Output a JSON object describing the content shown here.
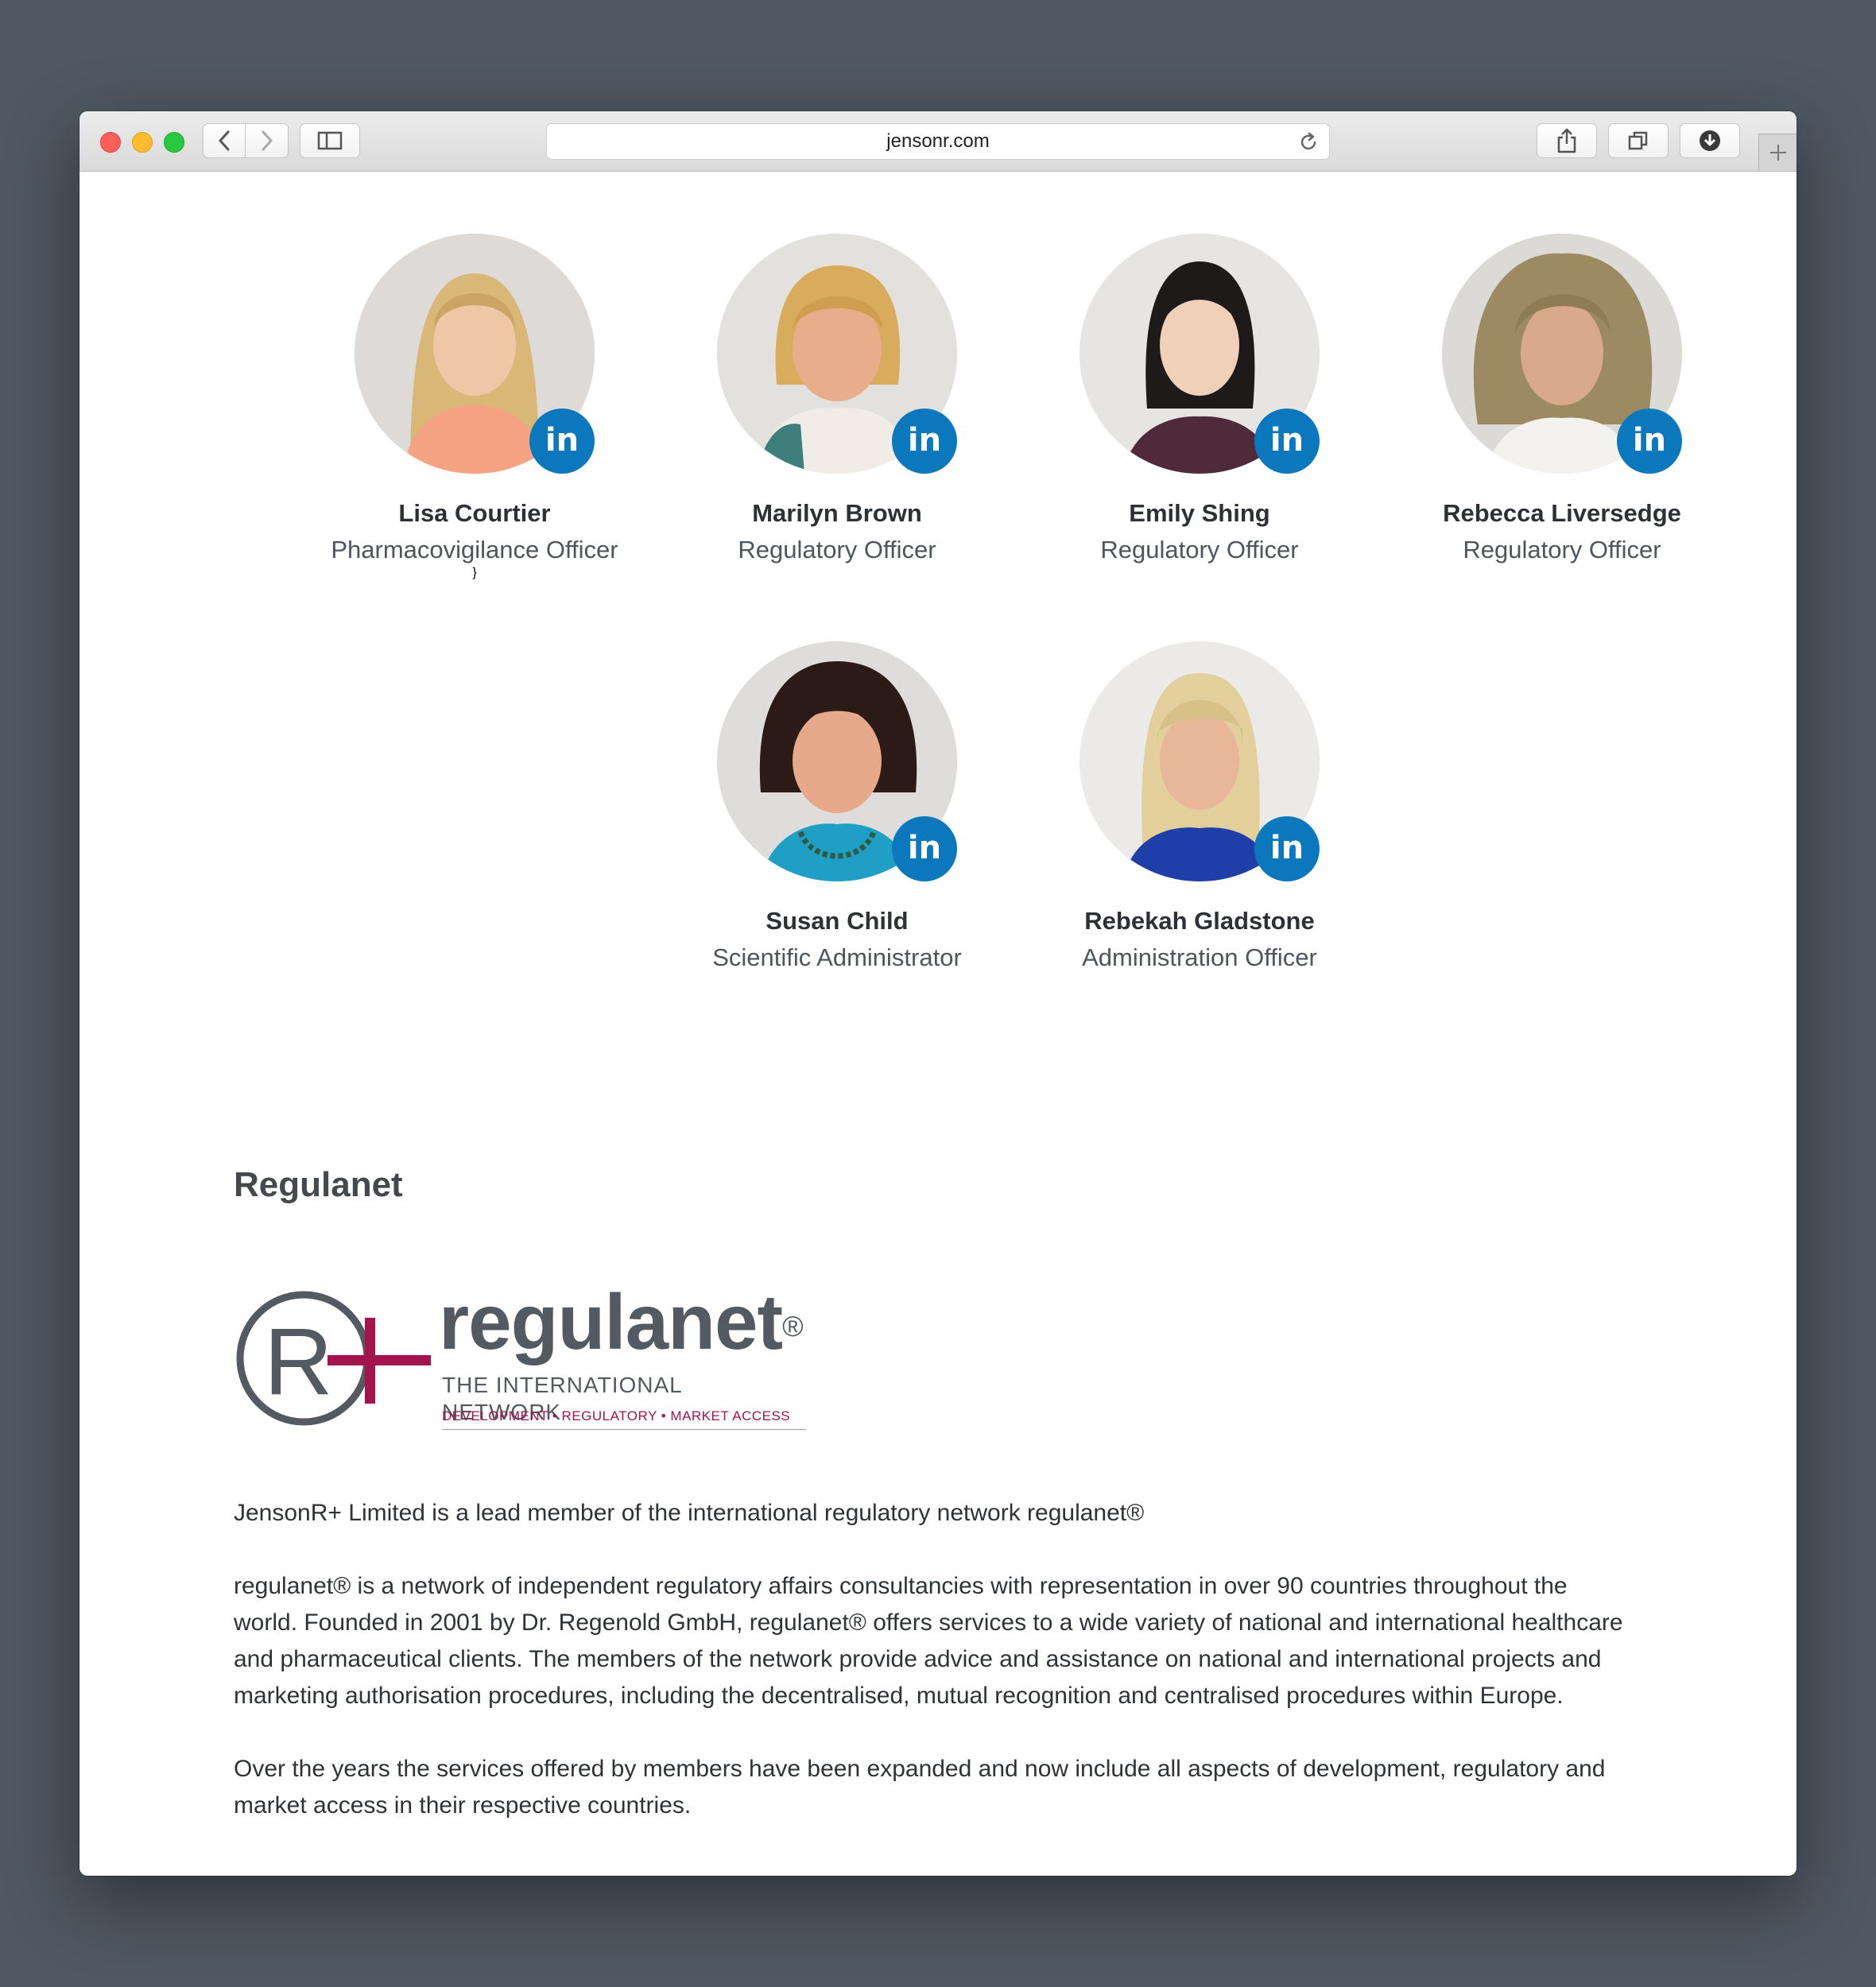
{
  "browser": {
    "url": "jensonr.com"
  },
  "team": [
    {
      "name": "Lisa Courtier",
      "role": "Pharmacovigilance Officer",
      "linkedin": "in"
    },
    {
      "name": "Marilyn Brown",
      "role": "Regulatory Officer",
      "linkedin": "in"
    },
    {
      "name": "Emily Shing",
      "role": "Regulatory Officer",
      "linkedin": "in"
    },
    {
      "name": "Rebecca Liversedge",
      "role": "Regulatory Officer",
      "linkedin": "in"
    },
    {
      "name": "Susan Child",
      "role": "Scientific Administrator",
      "linkedin": "in"
    },
    {
      "name": "Rebekah Gladstone",
      "role": "Administration Officer",
      "linkedin": "in"
    }
  ],
  "regulanet": {
    "heading": "Regulanet",
    "logo": {
      "wordmark": "regulanet",
      "registered": "®",
      "tagline": "THE INTERNATIONAL NETWORK",
      "services": "DEVELOPMENT • REGULATORY • MARKET ACCESS",
      "mark_letters": "R+"
    },
    "paragraphs": [
      "JensonR+ Limited is a lead member of the international regulatory network regulanet®",
      "regulanet® is a network of independent regulatory affairs consultancies with representation in over 90 countries throughout the world. Founded in 2001 by Dr. Regenold GmbH, regulanet® offers services to a wide variety of national and international healthcare and pharmaceutical clients. The members of the network provide advice and assistance on national and international projects and marketing authorisation procedures, including the decentralised, mutual recognition and centralised procedures within Europe.",
      "Over the years the services offered by members have been expanded and now include all aspects of development, regulatory and market access in their respective countries."
    ]
  },
  "colors": {
    "linkedin": "#0b77bd",
    "logo_grey": "#535a62",
    "logo_plus": "#a3134e",
    "page_bg": "#4f5963"
  },
  "icons": [
    "back-arrow-icon",
    "forward-arrow-icon",
    "sidebar-icon",
    "reload-icon",
    "share-icon",
    "tabs-icon",
    "download-icon",
    "plus-icon",
    "linkedin-icon"
  ]
}
